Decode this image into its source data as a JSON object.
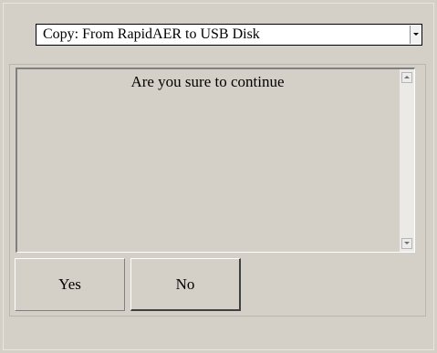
{
  "operation_select": {
    "selected_value": "Copy: From RapidAER to USB Disk"
  },
  "dialog": {
    "message": "Are you sure to continue"
  },
  "buttons": {
    "yes_label": "Yes",
    "no_label": "No"
  },
  "icons": {
    "dropdown": "chevron-down-icon",
    "scroll_up": "scroll-up-arrow-icon",
    "scroll_down": "scroll-down-arrow-icon"
  },
  "colors": {
    "background": "#d4d0c8",
    "field_background": "#ffffff",
    "text": "#000000"
  }
}
